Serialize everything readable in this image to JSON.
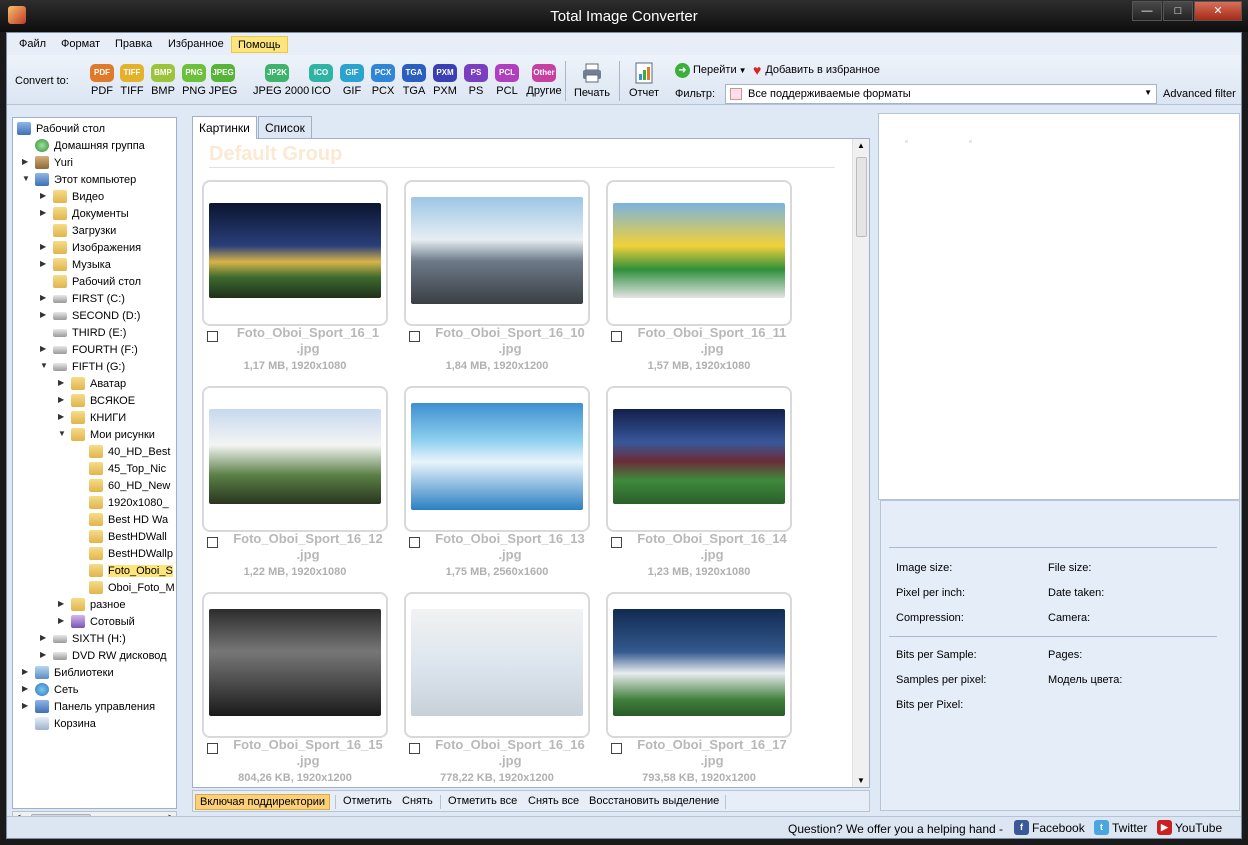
{
  "window": {
    "title": "Total Image Converter",
    "controls": [
      "—",
      "□",
      "✕"
    ]
  },
  "menu": [
    "Файл",
    "Формат",
    "Правка",
    "Избранное",
    "Помощь"
  ],
  "toolbar": {
    "convert_to": "Convert to:",
    "formats": [
      {
        "badge": "PDF",
        "label": "PDF",
        "color": "#e07a2b"
      },
      {
        "badge": "TIFF",
        "label": "TIFF",
        "color": "#e3b12a"
      },
      {
        "badge": "BMP",
        "label": "BMP",
        "color": "#9bc43a"
      },
      {
        "badge": "PNG",
        "label": "PNG",
        "color": "#6cc13a"
      },
      {
        "badge": "JPEG",
        "label": "JPEG",
        "color": "#56b437"
      },
      {
        "badge": "JP2K",
        "label": "JPEG 2000",
        "color": "#3db36b"
      },
      {
        "badge": "ICO",
        "label": "ICO",
        "color": "#2fb3a5"
      },
      {
        "badge": "GIF",
        "label": "GIF",
        "color": "#2aa3cf"
      },
      {
        "badge": "PCX",
        "label": "PCX",
        "color": "#2f86d6"
      },
      {
        "badge": "TGA",
        "label": "TGA",
        "color": "#2b5fbf"
      },
      {
        "badge": "PXM",
        "label": "PXM",
        "color": "#3a3fb3"
      },
      {
        "badge": "PS",
        "label": "PS",
        "color": "#7a3fbf"
      },
      {
        "badge": "PCL",
        "label": "PCL",
        "color": "#b03fbf"
      },
      {
        "badge": "Other",
        "label": "Другие",
        "color": "#c63fa3"
      }
    ],
    "print": "Печать",
    "report": "Отчет",
    "goto": "Перейти",
    "favorites": "Добавить в избранное",
    "filter_label": "Фильтр:",
    "filter_value": "Все поддерживаемые форматы",
    "advanced_filter": "Advanced filter"
  },
  "tree": [
    {
      "label": "Рабочий стол",
      "icon": "pc"
    },
    {
      "label": "Домашняя группа",
      "icon": "home"
    },
    {
      "label": "Yuri",
      "icon": "user"
    },
    {
      "label": "Этот компьютер",
      "icon": "pc"
    },
    {
      "label": "Видео",
      "icon": "folder"
    },
    {
      "label": "Документы",
      "icon": "folder"
    },
    {
      "label": "Загрузки",
      "icon": "folder"
    },
    {
      "label": "Изображения",
      "icon": "folder"
    },
    {
      "label": "Музыка",
      "icon": "folder"
    },
    {
      "label": "Рабочий стол",
      "icon": "folder"
    },
    {
      "label": "FIRST (C:)",
      "icon": "drive"
    },
    {
      "label": "SECOND (D:)",
      "icon": "drive"
    },
    {
      "label": "THIRD (E:)",
      "icon": "drive"
    },
    {
      "label": "FOURTH (F:)",
      "icon": "drive"
    },
    {
      "label": "FIFTH (G:)",
      "icon": "drive"
    },
    {
      "label": "Аватар",
      "icon": "folder"
    },
    {
      "label": "ВСЯКОЕ",
      "icon": "folder"
    },
    {
      "label": "КНИГИ",
      "icon": "folder"
    },
    {
      "label": "Мои рисунки",
      "icon": "folder"
    },
    {
      "label": "40_HD_Best",
      "icon": "folder"
    },
    {
      "label": "45_Top_Nic",
      "icon": "folder"
    },
    {
      "label": "60_HD_New",
      "icon": "folder"
    },
    {
      "label": "1920x1080_",
      "icon": "folder"
    },
    {
      "label": "Best HD Wa",
      "icon": "folder"
    },
    {
      "label": "BestHDWall",
      "icon": "folder"
    },
    {
      "label": "BestHDWallp",
      "icon": "folder"
    },
    {
      "label": "Foto_Oboi_S",
      "icon": "folder"
    },
    {
      "label": "Oboi_Foto_M",
      "icon": "folder"
    },
    {
      "label": "разное",
      "icon": "folder"
    },
    {
      "label": "Сотовый",
      "icon": "phone"
    },
    {
      "label": "SIXTH (H:)",
      "icon": "drive"
    },
    {
      "label": "DVD RW дисковод",
      "icon": "drive"
    },
    {
      "label": "Библиотеки",
      "icon": "lib"
    },
    {
      "label": "Сеть",
      "icon": "net"
    },
    {
      "label": "Панель управления",
      "icon": "pc"
    },
    {
      "label": "Корзина",
      "icon": "bin"
    }
  ],
  "tabs": [
    "Картинки",
    "Список"
  ],
  "gallery": {
    "ghost_title": "Default Group",
    "items": [
      {
        "name": "Foto_Oboi_Sport_16_1.jpg",
        "info": "1,17 MB, 1920x1080"
      },
      {
        "name": "Foto_Oboi_Sport_16_10.jpg",
        "info": "1,84 MB, 1920x1200"
      },
      {
        "name": "Foto_Oboi_Sport_16_11.jpg",
        "info": "1,57 MB, 1920x1080"
      },
      {
        "name": "Foto_Oboi_Sport_16_12.jpg",
        "info": "1,22 MB, 1920x1080"
      },
      {
        "name": "Foto_Oboi_Sport_16_13.jpg",
        "info": "1,75 MB, 2560x1600"
      },
      {
        "name": "Foto_Oboi_Sport_16_14.jpg",
        "info": "1,23 MB, 1920x1080"
      },
      {
        "name": "Foto_Oboi_Sport_16_15.jpg",
        "info": "804,26 KB, 1920x1200"
      },
      {
        "name": "Foto_Oboi_Sport_16_16.jpg",
        "info": "778,22 KB, 1920x1200"
      },
      {
        "name": "Foto_Oboi_Sport_16_17.jpg",
        "info": "793,58 KB, 1920x1200"
      }
    ]
  },
  "bottom_buttons": [
    "Включая поддиректории",
    "Отметить",
    "Снять",
    "Отметить все",
    "Снять все",
    "Восстановить выделение"
  ],
  "properties": {
    "image_size": "Image size:",
    "file_size": "File size:",
    "pixel_per_inch": "Pixel per inch:",
    "date_taken": "Date taken:",
    "compression": "Compression:",
    "camera": "Camera:",
    "bits_per_sample": "Bits per Sample:",
    "pages": "Pages:",
    "samples_per_pixel": "Samples per pixel:",
    "color_model": "Модель цвета:",
    "bits_per_pixel": "Bits per Pixel:"
  },
  "status": {
    "help": "Question? We offer you a helping hand -",
    "facebook": "Facebook",
    "twitter": "Twitter",
    "youtube": "YouTube"
  }
}
